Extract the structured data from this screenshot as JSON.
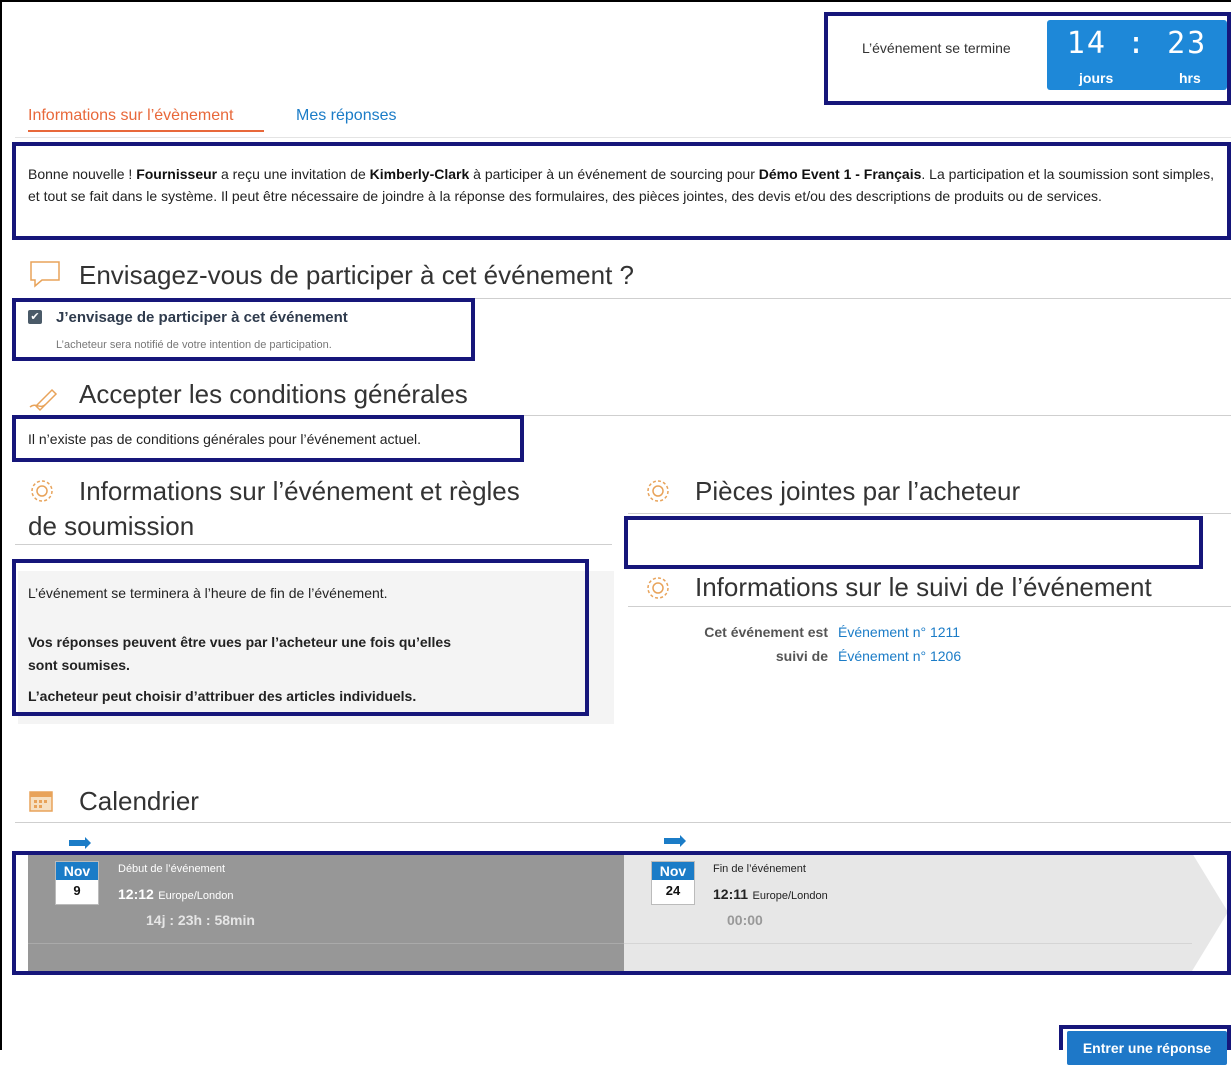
{
  "countdown": {
    "label": "L’événement se termine",
    "days": "14",
    "hours": "23",
    "days_unit": "jours",
    "hours_unit": "hrs"
  },
  "tabs": {
    "event_info": "Informations sur l’évènement",
    "my_responses": "Mes réponses"
  },
  "intro": {
    "p1": "Bonne nouvelle ! ",
    "supplier": "Fournisseur",
    "p2": " a reçu une invitation de ",
    "buyer": "Kimberly-Clark",
    "p3": " à participer à un événement de sourcing pour ",
    "event": "Démo Event 1 - Français",
    "p4": ". La participation et la soumission sont simples, et tout se fait dans le système. Il peut être nécessaire de joindre à la réponse des formulaires, des pièces jointes, des devis et/ou des descriptions de produits ou de services."
  },
  "participation": {
    "title": "Envisagez-vous de participer à cet événement ?",
    "checkbox_label": "J’envisage de participer à cet événement",
    "checkbox_sub": "L’acheteur sera notifié de votre intention de participation."
  },
  "terms": {
    "title": "Accepter les conditions générales",
    "text": "Il n’existe pas de conditions générales pour l’événement actuel."
  },
  "rules": {
    "title_line1": "Informations sur l’événement et règles",
    "title_line2": "de soumission",
    "line1": "L’événement se terminera à l’heure de fin de l’événement.",
    "line2a": "Vos réponses peuvent être vues par l’acheteur une fois qu’elles",
    "line2b": "sont soumises.",
    "line3": "L’acheteur peut choisir d’attribuer des articles individuels."
  },
  "attachments": {
    "title": "Pièces jointes par l’acheteur"
  },
  "follow": {
    "title": "Informations sur le suivi de l’événement",
    "label1": "Cet événement est",
    "label2": "suivi de",
    "link1": "Événement n° 1211",
    "link2": "Événement n° 1206"
  },
  "calendar": {
    "title": "Calendrier",
    "start": {
      "month": "Nov",
      "day": "9",
      "label": "Début de l’événement",
      "time": "12:12",
      "tz": "Europe/London",
      "remaining": "14j : 23h : 58min"
    },
    "end": {
      "month": "Nov",
      "day": "24",
      "label": "Fin de l’événement",
      "time": "12:11",
      "tz": "Europe/London",
      "remaining": "00:00"
    }
  },
  "actions": {
    "enter_response": "Entrer une réponse"
  },
  "colors": {
    "accent": "#1b7cc7",
    "tab_active": "#e8683a",
    "highlight": "#16167a"
  }
}
